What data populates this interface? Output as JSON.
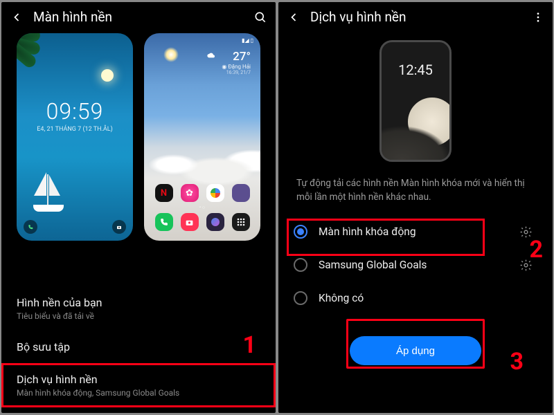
{
  "left": {
    "title": "Màn hình nền",
    "lock_preview": {
      "time": "09:59",
      "date": "E4, 21 THÁNG 7 (12 TH.ÂL)"
    },
    "home_preview": {
      "temp": "27°",
      "location": "Đặng Hải",
      "updated": "16:39, 21/7"
    },
    "your_wallpapers": {
      "label": "Hình nền của bạn",
      "sub": "Tiêu biểu và đã tải về"
    },
    "collection": {
      "label": "Bộ sưu tập"
    },
    "service": {
      "label": "Dịch vụ hình nền",
      "sub": "Màn hình khóa động, Samsung Global Goals"
    },
    "callout": "1"
  },
  "right": {
    "title": "Dịch vụ hình nền",
    "preview_time": "12:45",
    "desc": "Tự động tải các hình nền Màn hình khóa mới và hiển thị mỗi lần một hình nền khác nhau.",
    "options": {
      "dynamic": "Màn hình khóa động",
      "goals": "Samsung Global Goals",
      "none": "Không có"
    },
    "apply": "Áp dụng",
    "callout2": "2",
    "callout3": "3"
  }
}
